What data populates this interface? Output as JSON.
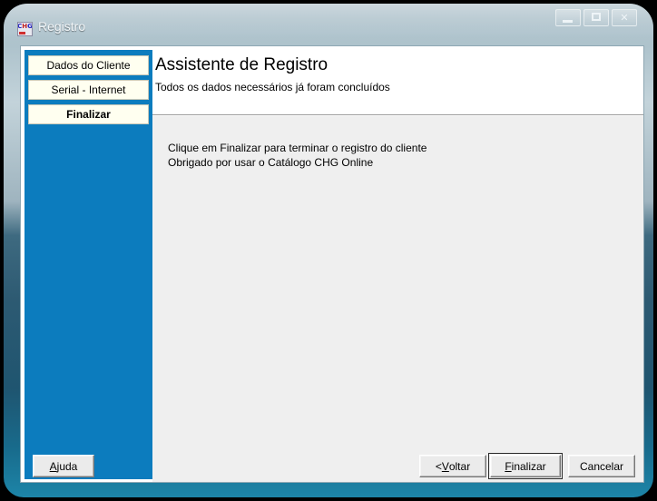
{
  "window": {
    "title": "Registro",
    "icon_name": "chg-app-icon",
    "icon_text": "CHG",
    "controls": [
      {
        "name": "minimize-button",
        "glyph": "minimize"
      },
      {
        "name": "maximize-button",
        "glyph": "maximize"
      },
      {
        "name": "close-button",
        "glyph": "✕"
      }
    ]
  },
  "sidebar": {
    "background_color": "#0c7cbe",
    "items": [
      {
        "label": "Dados do Cliente",
        "active": false
      },
      {
        "label": "Serial - Internet",
        "active": false
      },
      {
        "label": "Finalizar",
        "active": true
      }
    ]
  },
  "header": {
    "title": "Assistente de Registro",
    "subtitle": "Todos os dados necessários já foram concluídos"
  },
  "content": {
    "line1": "Clique em Finalizar para terminar o registro do cliente",
    "line2": "Obrigado por usar o Catálogo CHG Online",
    "background_color": "#efefef"
  },
  "buttons": {
    "help": {
      "prefix": "",
      "accel": "A",
      "suffix": "juda"
    },
    "back": {
      "prefix": "< ",
      "accel": "V",
      "suffix": "oltar"
    },
    "finish": {
      "prefix": "",
      "accel": "F",
      "suffix": "inalizar",
      "is_default": true
    },
    "cancel": {
      "prefix": "",
      "accel": "",
      "suffix": "Cancelar"
    }
  }
}
